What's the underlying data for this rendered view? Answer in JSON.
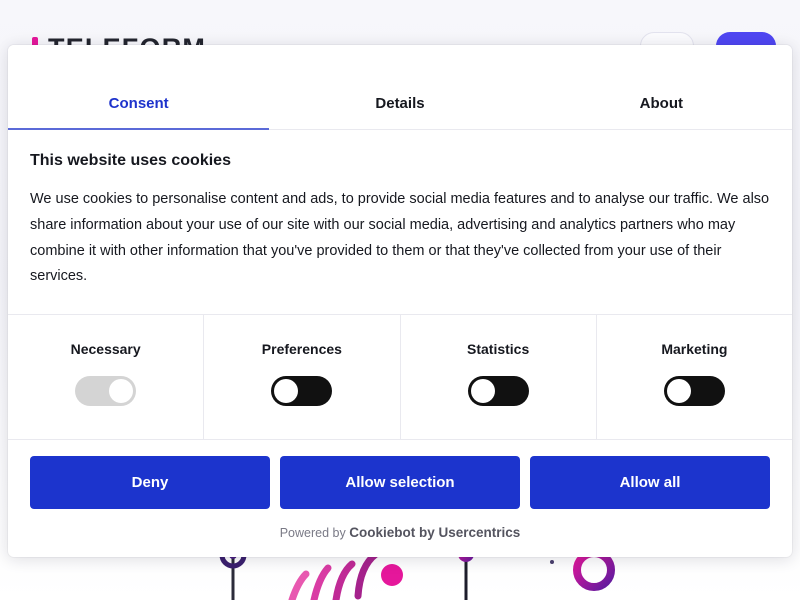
{
  "background_page": {
    "brand_word": "TELEFORM",
    "brand_mark_icon": "bar-chart-logo-icon",
    "header_link": "",
    "outline_button": "",
    "primary_button": ""
  },
  "dialog": {
    "tabs": [
      {
        "label": "Consent",
        "active": true
      },
      {
        "label": "Details",
        "active": false
      },
      {
        "label": "About",
        "active": false
      }
    ],
    "title": "This website uses cookies",
    "text": "We use cookies to personalise content and ads, to provide social media features and to analyse our traffic. We also share information about your use of our site with our social media, advertising and analytics partners who may combine it with other information that you've provided to them or that they've collected from your use of their services.",
    "categories": [
      {
        "label": "Necessary",
        "state": "on",
        "locked": true
      },
      {
        "label": "Preferences",
        "state": "off",
        "locked": false
      },
      {
        "label": "Statistics",
        "state": "off",
        "locked": false
      },
      {
        "label": "Marketing",
        "state": "off",
        "locked": false
      }
    ],
    "actions": [
      {
        "label": "Deny"
      },
      {
        "label": "Allow selection"
      },
      {
        "label": "Allow all"
      }
    ],
    "powered_prefix": "Powered by ",
    "powered_brand": "Cookiebot by Usercentrics"
  },
  "colors": {
    "accent_blue": "#1c34cd",
    "tab_active": "#1e33cc",
    "toggle_on_track": "#111111",
    "toggle_locked_track": "#d4d4d4",
    "brand_magenta": "#e5179b",
    "header_button_purple": "#4f46f2"
  }
}
